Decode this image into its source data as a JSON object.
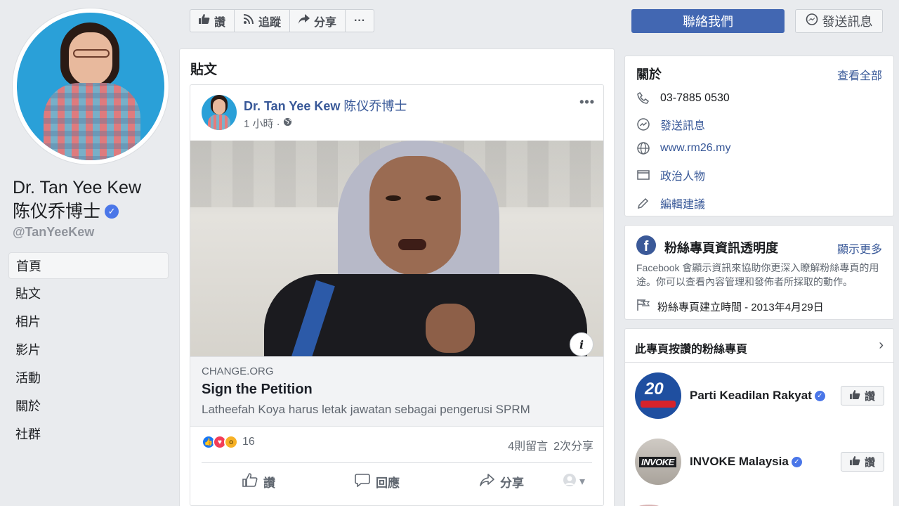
{
  "profile": {
    "name_line1": "Dr. Tan Yee Kew",
    "name_line2": "陈仪乔博士",
    "handle": "@TanYeeKew"
  },
  "nav": [
    {
      "label": "首頁",
      "active": true
    },
    {
      "label": "貼文"
    },
    {
      "label": "相片"
    },
    {
      "label": "影片"
    },
    {
      "label": "活動"
    },
    {
      "label": "關於"
    },
    {
      "label": "社群"
    }
  ],
  "actionbar": {
    "like": "讚",
    "follow": "追蹤",
    "share": "分享",
    "more": "···"
  },
  "header_buttons": {
    "contact": "聯絡我們",
    "message": "發送訊息"
  },
  "posts_section": {
    "title": "貼文",
    "post": {
      "author": "Dr. Tan Yee Kew",
      "author_cn": "陈仪乔博士",
      "time": "1 小時 ·",
      "more": "•••",
      "link": {
        "domain": "CHANGE.ORG",
        "title": "Sign the Petition",
        "description": "Latheefah Koya harus letak jawatan sebagai pengerusi SPRM"
      },
      "reaction_count": "16",
      "comments": "4則留言",
      "shares": "2次分享",
      "actions": {
        "like": "讚",
        "comment": "回應",
        "share": "分享"
      }
    }
  },
  "about": {
    "title": "關於",
    "see_all": "查看全部",
    "phone": "03-7885 0530",
    "message": "發送訊息",
    "website": "www.rm26.my",
    "category": "政治人物",
    "suggest_edits": "編輯建議"
  },
  "transparency": {
    "title": "粉絲專頁資訊透明度",
    "see_more": "顯示更多",
    "description": "Facebook 會顯示資訊來協助你更深入瞭解粉絲專頁的用途。你可以查看內容管理和發佈者所採取的動作。",
    "created": "粉絲專頁建立時間 - 2013年4月29日"
  },
  "liked_pages": {
    "title": "此專頁按讚的粉絲專頁",
    "items": [
      {
        "name": "Parti Keadilan Rakyat",
        "like": "讚"
      },
      {
        "name": "INVOKE Malaysia",
        "like": "讚",
        "logo_text": "INVOKE"
      }
    ]
  },
  "colors": {
    "brand": "#4267b2",
    "link": "#385898",
    "background": "#e9ebee"
  }
}
